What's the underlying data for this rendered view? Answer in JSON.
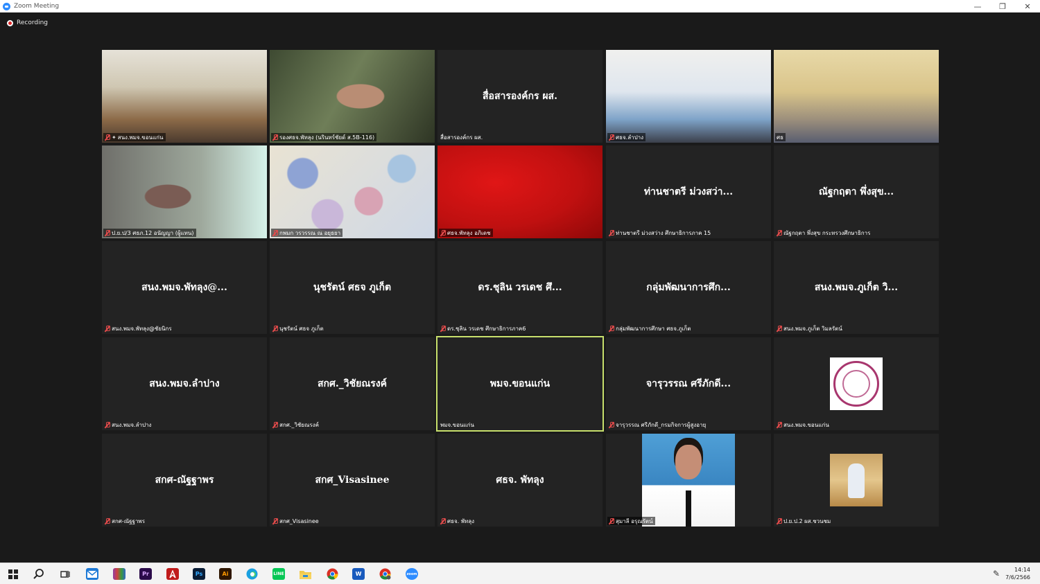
{
  "window": {
    "title": "Zoom Meeting",
    "minimize": "—",
    "restore": "❐",
    "close": "✕"
  },
  "recording": {
    "label": "Recording"
  },
  "tiles": [
    {
      "name": "สนง.พมจ.ขอนแก่น",
      "pinned": true
    },
    {
      "name": "รองศธจ.พัทลุง (นรินทร์ชัยด์ ส.5B-116)"
    },
    {
      "bigname": "สื่อสารองค์กร ผส.",
      "name": "สื่อสารองค์กร ผส."
    },
    {
      "name": "ศธจ.ลำปาง"
    },
    {
      "name": "ศธ"
    },
    {
      "name": "ป.ย.ป/3 ศธภ.12 อนัญญา (ผู้แทน)"
    },
    {
      "name": "กพมก วรวรรณ ณ อยุธยา"
    },
    {
      "name": "ศธจ.พัทลุง อภิเดช"
    },
    {
      "bigname": "ท่านชาตรี ม่วงสว่า...",
      "name": "ท่านชาตรี ม่วงสว่าง ศึกษาธิการภาค 15"
    },
    {
      "bigname": "ณัฐกฤตา พึ่งสุข...",
      "name": "ณัฐกฤตา พึ่งสุข กระทรวงศึกษาธิการ"
    },
    {
      "bigname": "สนง.พมจ.พัทลุง@...",
      "name": "สนง.พมจ.พัทลุง@ชัยนิกร"
    },
    {
      "bigname": "นุชรัตน์ ศธจ ภูเก็ต",
      "name": "นุชรัตน์ ศธจ ภูเก็ต"
    },
    {
      "bigname": "ดร.ชุลิน วรเดช ศึ...",
      "name": "ดร.ชุลิน วรเดช ศึกษาธิการภาค6"
    },
    {
      "bigname": "กลุ่มพัฒนาการศึก...",
      "name": "กลุ่มพัฒนาการศึกษา ศธจ.ภูเก็ต"
    },
    {
      "bigname": "สนง.พมจ.ภูเก็ต วิ...",
      "name": "สนง.พมจ.ภูเก็ต วิมลรัตน์"
    },
    {
      "bigname": "สนง.พมจ.ลำปาง",
      "name": "สนง.พมจ.ลำปาง"
    },
    {
      "bigname": "สกศ._วิชัยณรงค์",
      "name": "สกศ._วิชัยณรงค์"
    },
    {
      "bigname": "พมจ.ขอนแก่น",
      "name": "พมจ.ขอนแก่น",
      "active": true
    },
    {
      "bigname": "จารุวรรณ ศรีภักดี...",
      "name": "จารุวรรณ ศรีภักดี_กรมกิจการผู้สูงอายุ"
    },
    {
      "name": "สนง.พมจ.ขอนแก่น"
    },
    {
      "bigname": "สกศ-ณัฐฐาพร",
      "name": "สกศ-ณัฐฐาพร"
    },
    {
      "bigname": "สกศ_Visasinee",
      "name": "สกศ_Visasinee"
    },
    {
      "bigname": "ศธจ. พัทลุง",
      "name": "ศธจ. พัทลุง"
    },
    {
      "name": "สุมาลี อรุณรัตน์"
    },
    {
      "name": "ป.ย.ป.2 ผส.ชวนชม"
    }
  ],
  "taskbar": {
    "apps": [
      "start-icon",
      "search-icon",
      "task-view-icon",
      "mail-icon",
      "winrar-icon",
      "premiere-icon",
      "acrobat-icon",
      "photoshop-icon",
      "illustrator-icon",
      "edge-icon",
      "line-icon",
      "explorer-icon",
      "chrome-icon",
      "word-icon",
      "chrome-profile-icon",
      "zoom-icon"
    ],
    "labels": {
      "premiere": "Pr",
      "photoshop": "Ps",
      "illustrator": "Ai",
      "word": "W",
      "line": "LINE",
      "zoom": "zoom"
    },
    "time": "14:14",
    "date": "7/6/2566"
  }
}
